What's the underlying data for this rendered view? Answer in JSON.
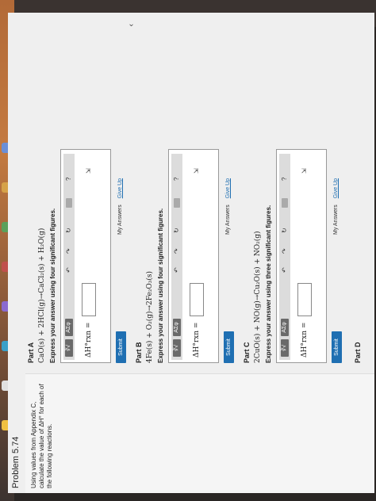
{
  "problem": {
    "title": "Problem 5.74"
  },
  "instructions": "Using values from Appendix C, calculate the value of ΔH° for each of the following reactions.",
  "toolbar": {
    "sqrt_label": "∛√",
    "greek_label": "AΣφ",
    "undo_label": "↶",
    "redo_label": "↷",
    "reset_label": "↻",
    "help_label": "?"
  },
  "dh_label": "ΔH°rxn =",
  "parts": [
    {
      "label": "Part A",
      "reaction": "CaO(s) + 2HCl(g)→CaCl₂(s) + H₂O(g)",
      "prompt": "Express your answer using four significant figures.",
      "submit": "Submit",
      "my_answers": "My Answers",
      "give_up": "Give Up"
    },
    {
      "label": "Part B",
      "reaction": "4Fe(s) + O₂(g)→2Fe₂O₃(s)",
      "prompt": "Express your answer using four significant figures.",
      "submit": "Submit",
      "my_answers": "My Answers",
      "give_up": "Give Up"
    },
    {
      "label": "Part C",
      "reaction": "2CuO(s) + NO(g)→Cu₂O(s) + NO₂(g)",
      "prompt": "Express your answer using three significant figures.",
      "submit": "Submit",
      "my_answers": "My Answers",
      "give_up": "Give Up"
    },
    {
      "label": "Part D"
    }
  ]
}
